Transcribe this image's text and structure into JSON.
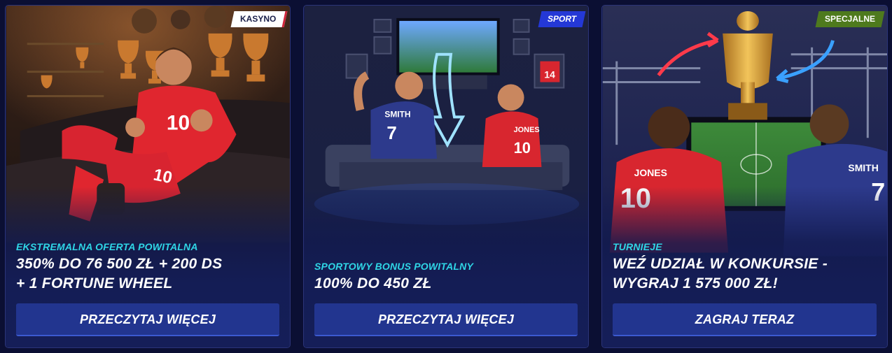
{
  "cards": [
    {
      "badge": "KASYNO",
      "subtitle": "EKSTREMALNA OFERTA POWITALNA",
      "title_line1": "350% DO 76 500 ZŁ + 200 DS",
      "title_line2": "+ 1 FORTUNE WHEEL",
      "button": "PRZECZYTAJ WIĘCEJ",
      "jersey_number": "10"
    },
    {
      "badge": "SPORT",
      "subtitle": "SPORTOWY BONUS POWITALNY",
      "title_line1": "100% DO 450 ZŁ",
      "button": "PRZECZYTAJ WIĘCEJ",
      "left_player_name": "SMITH",
      "left_player_number": "7",
      "right_player_name": "JONES",
      "right_player_number": "10",
      "poster_number": "14"
    },
    {
      "badge": "SPECJALNE",
      "subtitle": "TURNIEJE",
      "title_line1": "WEŹ UDZIAŁ W KONKURSIE -",
      "title_line2": "WYGRAJ 1 575 000 ZŁ!",
      "button": "ZAGRAJ TERAZ",
      "left_player_name": "JONES",
      "left_player_number": "10",
      "right_player_name": "SMITH",
      "right_player_number": "7"
    }
  ],
  "colors": {
    "page_background": "#0b0f33",
    "card_background": "#151e58",
    "button": "#22358f",
    "subtitle": "#2fd6e6",
    "badge_casino": "#ffffff",
    "badge_sport": "#2438d6",
    "badge_special": "#4e7a1d"
  }
}
